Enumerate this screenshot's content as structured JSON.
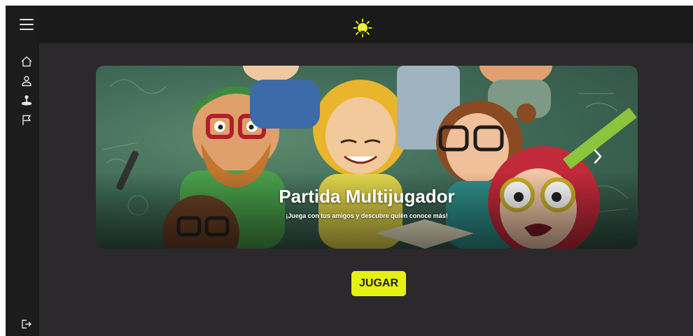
{
  "banner": {
    "title": "Partida Multijugador",
    "subtitle": "¡Juega con tus amigos y descubre quién conoce más!"
  },
  "play_button": {
    "label": "JUGAR"
  },
  "icons": {
    "menu": "hamburger-menu-icon",
    "home": "home-icon",
    "profile": "user-icon",
    "game": "joystick-icon",
    "flag": "flag-icon",
    "logout": "logout-icon",
    "logo": "lightbulb-sun-icon",
    "next": "chevron-right-icon"
  },
  "colors": {
    "accent": "#e6f015",
    "sidebar": "#1c1c1c",
    "topbar": "#1a1a1a",
    "background": "#2b292b"
  }
}
